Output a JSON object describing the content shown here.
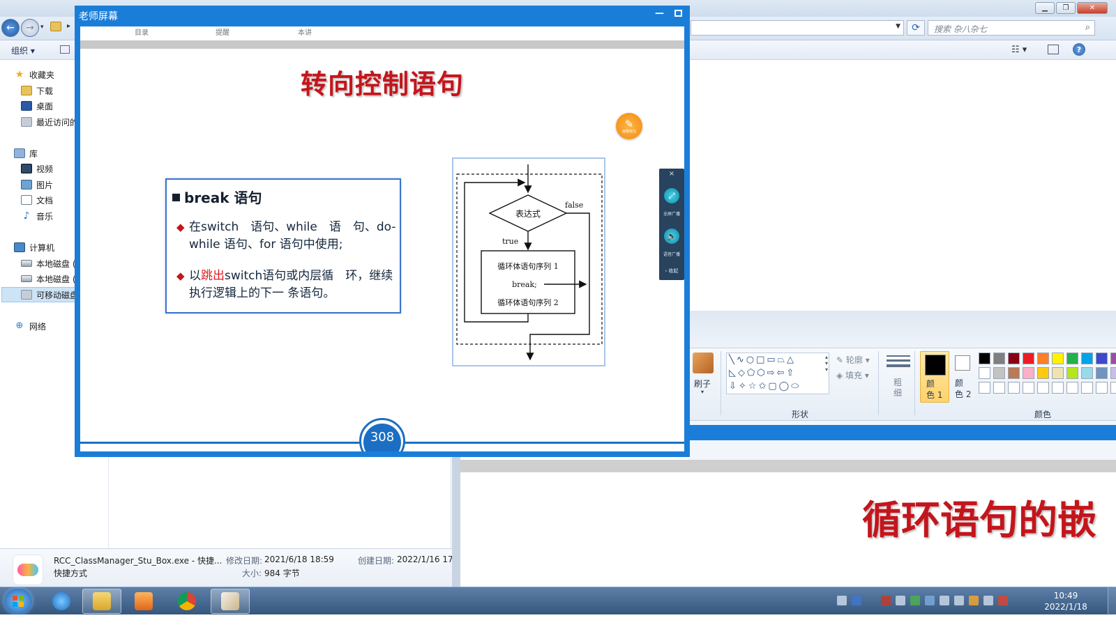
{
  "explorer": {
    "search_placeholder": "搜索 杂八杂七",
    "organize_label": "组织 ▾",
    "nav": {
      "favorites": "收藏夹",
      "downloads": "下载",
      "desktop": "桌面",
      "recent": "最近访问的",
      "libraries": "库",
      "videos": "视频",
      "pictures": "图片",
      "documents": "文档",
      "music": "音乐",
      "computer": "计算机",
      "local_disk_c": "本地磁盘 (",
      "local_disk_d": "本地磁盘 (",
      "removable": "可移动磁盘",
      "network": "网络"
    },
    "details": {
      "file_name": "RCC_ClassManager_Stu_Box.exe - 快捷...",
      "file_type": "快捷方式",
      "modified_label": "修改日期:",
      "modified_value": "2021/6/18 18:59",
      "created_label": "创建日期:",
      "created_value": "2022/1/16 17:",
      "size_label": "大小:",
      "size_value": "984 字节"
    }
  },
  "teacher_window": {
    "title": "老师屏幕",
    "minimize_glyph": "—",
    "slide": {
      "title": "转向控制语句",
      "annotate_label": "画笔标注",
      "header_ghost": [
        "目录",
        "提醒",
        "本讲"
      ],
      "box_heading": "break 语句",
      "bullet1": "在switch　语句、while　语　句、do-while 语句、for  语句中使用;",
      "bullet2_pre": "以",
      "bullet2_red": "跳出",
      "bullet2_post": "switch语句或内层循　环，继续执行逻辑上的下一 条语句。",
      "flow": {
        "condition": "表达式",
        "false_label": "false",
        "true_label": "true",
        "seq1": "循环体语句序列 1",
        "break_stmt": "break;",
        "seq2": "循环体语句序列 2"
      },
      "page_number": "308"
    },
    "side_panel": {
      "close": "×",
      "fullscreen_label": "全屏广播",
      "voice_label": "语音广播",
      "collapse_label": "› 收起"
    }
  },
  "paint": {
    "brush_label": "刷子",
    "outline_label": "轮廓 ▾",
    "fill_label": "填充 ▾",
    "size_label": "粗\n细",
    "color1_label": "颜\n色 1",
    "color2_label": "颜\n色 2",
    "shapes_group": "形状",
    "colors_group": "颜色",
    "slide_title_partial": "循环语句的嵌",
    "palette": [
      "#000000",
      "#7f7f7f",
      "#880015",
      "#ed1c24",
      "#ff7f27",
      "#fff200",
      "#22b14c",
      "#00a2e8",
      "#3f48cc",
      "#a349a4",
      "#ffffff",
      "#c3c3c3",
      "#b97a57",
      "#ffaec9",
      "#ffc90e",
      "#efe4b0",
      "#b5e61d",
      "#99d9ea",
      "#7092be",
      "#c8bfe7",
      "#ffffff",
      "#ffffff",
      "#ffffff",
      "#ffffff",
      "#ffffff",
      "#ffffff",
      "#ffffff",
      "#ffffff",
      "#ffffff",
      "#ffffff"
    ]
  },
  "taskbar": {
    "time": "10:49",
    "date": "2022/1/18"
  }
}
